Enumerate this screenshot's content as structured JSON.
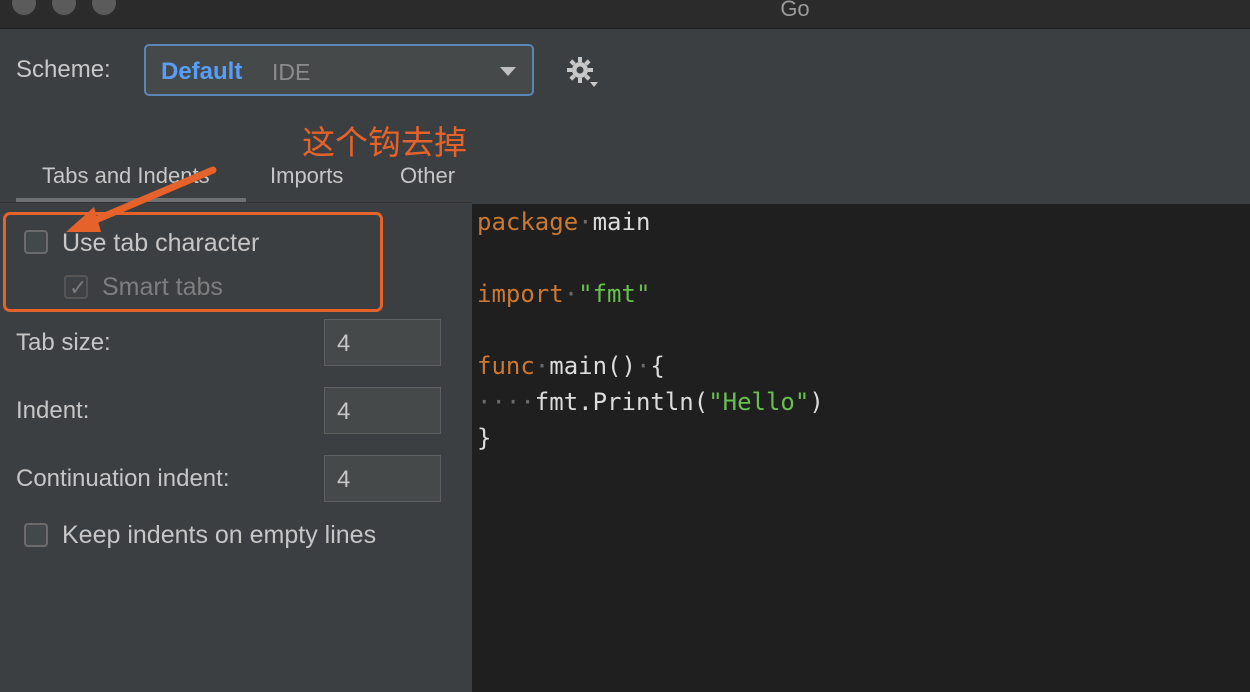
{
  "window": {
    "title": "Go"
  },
  "scheme": {
    "label": "Scheme:",
    "name": "Default",
    "sub": "IDE"
  },
  "annotation": {
    "text": "这个钩去掉"
  },
  "tabs": [
    {
      "label": "Tabs and Indents",
      "active": true
    },
    {
      "label": "Imports",
      "active": false
    },
    {
      "label": "Other",
      "active": false
    }
  ],
  "options": {
    "use_tab_character": {
      "label": "Use tab character",
      "checked": false
    },
    "smart_tabs": {
      "label": "Smart tabs",
      "checked": true,
      "enabled": false
    },
    "tab_size": {
      "label": "Tab size:",
      "value": "4"
    },
    "indent": {
      "label": "Indent:",
      "value": "4"
    },
    "continuation_indent": {
      "label": "Continuation indent:",
      "value": "4"
    },
    "keep_indents": {
      "label": "Keep indents on empty lines",
      "checked": false
    }
  },
  "code": {
    "l1_kw": "package",
    "l1_rest": "main",
    "l3_kw": "import",
    "l3_str": "\"fmt\"",
    "l5_kw": "func",
    "l5_rest": "main()",
    "l5_brace": "{",
    "l6_call": "fmt.Println(",
    "l6_str": "\"Hello\"",
    "l6_close": ")",
    "l7": "}"
  },
  "colors": {
    "accent": "#589df6",
    "annotation": "#e5622a",
    "keyword": "#cc7832",
    "string": "#67c04e"
  }
}
